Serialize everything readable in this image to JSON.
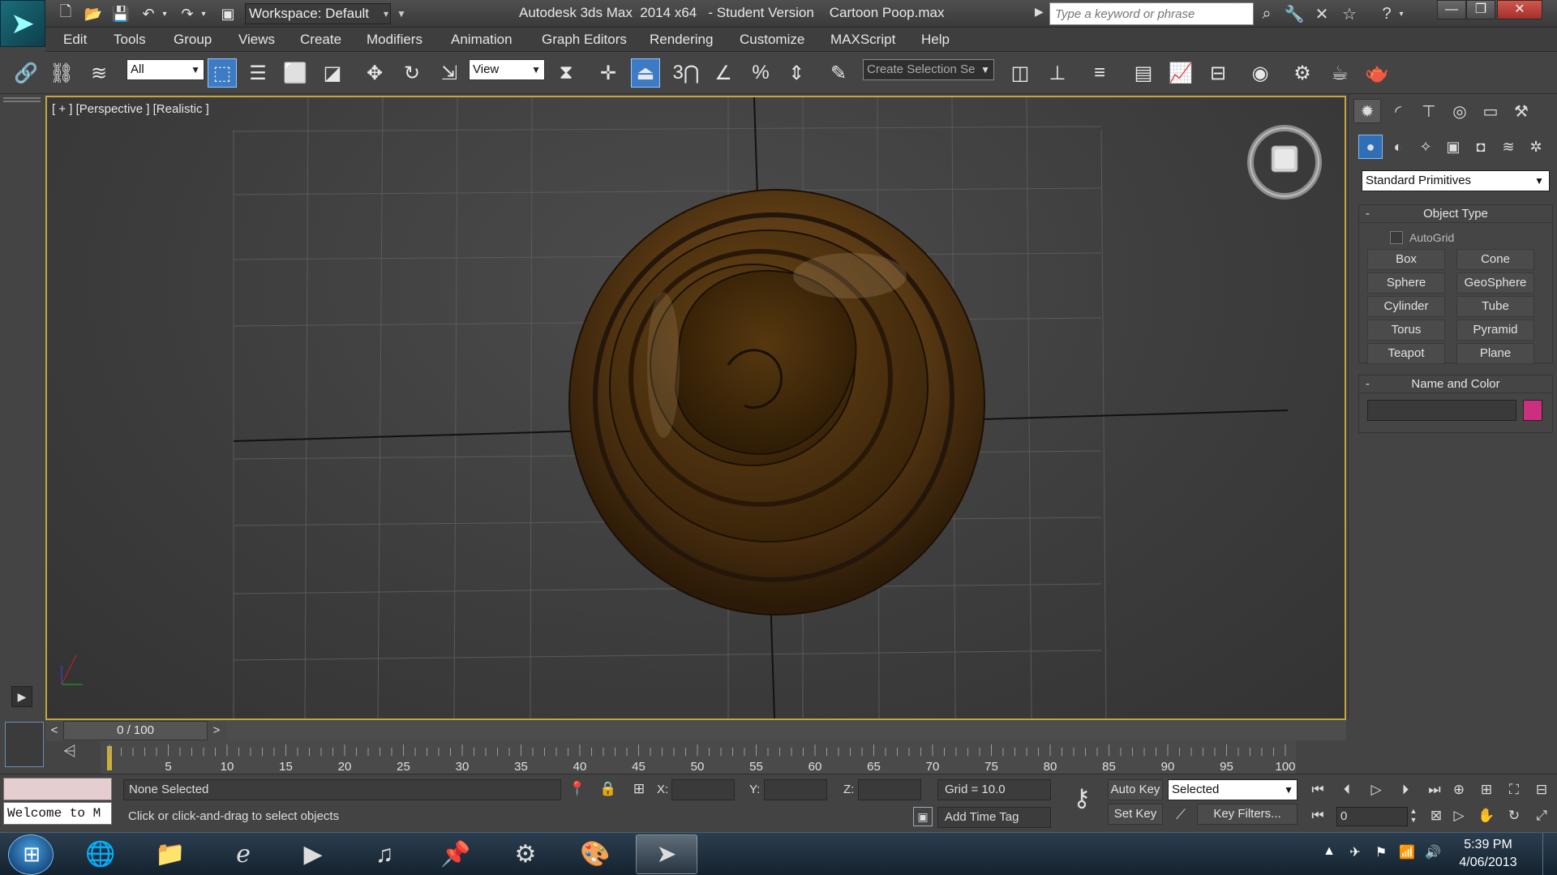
{
  "window": {
    "title": "Autodesk 3ds Max  2014 x64   - Student Version    Cartoon Poop.max",
    "workspace": "Workspace: Default",
    "search_placeholder": "Type a keyword or phrase"
  },
  "menu": [
    "Edit",
    "Tools",
    "Group",
    "Views",
    "Create",
    "Modifiers",
    "Animation",
    "Graph Editors",
    "Rendering",
    "Customize",
    "MAXScript",
    "Help"
  ],
  "toolbar": {
    "selection_filter": "All",
    "reference_coord": "View",
    "snap_3": "3",
    "selection_set_placeholder": "Create Selection Se"
  },
  "viewport": {
    "label": "[ + ] [Perspective ] [Realistic ]",
    "object_color": "#5a3a14",
    "border_color": "#c7a43b"
  },
  "command_panel": {
    "category": "Standard Primitives",
    "object_type": {
      "title": "Object Type",
      "autogrid": "AutoGrid",
      "buttons": [
        "Box",
        "Cone",
        "Sphere",
        "GeoSphere",
        "Cylinder",
        "Tube",
        "Torus",
        "Pyramid",
        "Teapot",
        "Plane"
      ]
    },
    "name_color": {
      "title": "Name and Color",
      "name_value": "",
      "swatch": "#cc2f80"
    }
  },
  "time_slider": {
    "frame": "0 / 100",
    "prev": "<",
    "next": ">",
    "ticks": [
      "5",
      "10",
      "15",
      "20",
      "25",
      "30",
      "35",
      "40",
      "45",
      "50",
      "55",
      "60",
      "65",
      "70",
      "75",
      "80",
      "85",
      "90",
      "95",
      "100"
    ]
  },
  "status": {
    "listener": "Welcome to M",
    "selection": "None Selected",
    "prompt": "Click or click-and-drag to select objects",
    "x_label": "X:",
    "y_label": "Y:",
    "z_label": "Z:",
    "grid": "Grid = 10.0",
    "add_time_tag": "Add Time Tag",
    "auto_key": "Auto Key",
    "set_key": "Set Key",
    "key_mode": "Selected",
    "key_filters": "Key Filters...",
    "current_frame": "0"
  },
  "taskbar": {
    "time": "5:39 PM",
    "date": "4/06/2013"
  }
}
